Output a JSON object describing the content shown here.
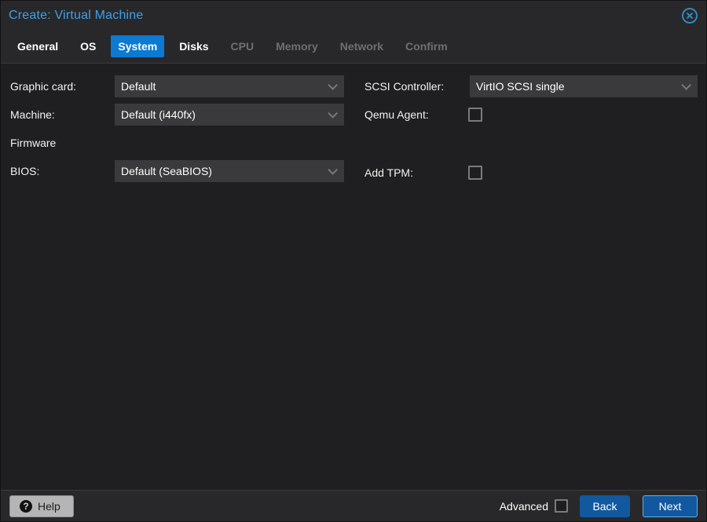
{
  "window": {
    "title": "Create: Virtual Machine"
  },
  "tabs": [
    {
      "label": "General",
      "state": "enabled"
    },
    {
      "label": "OS",
      "state": "enabled"
    },
    {
      "label": "System",
      "state": "active"
    },
    {
      "label": "Disks",
      "state": "enabled"
    },
    {
      "label": "CPU",
      "state": "disabled"
    },
    {
      "label": "Memory",
      "state": "disabled"
    },
    {
      "label": "Network",
      "state": "disabled"
    },
    {
      "label": "Confirm",
      "state": "disabled"
    }
  ],
  "form": {
    "left": {
      "graphic_card": {
        "label": "Graphic card:",
        "value": "Default"
      },
      "machine": {
        "label": "Machine:",
        "value": "Default (i440fx)"
      },
      "firmware_section": "Firmware",
      "bios": {
        "label": "BIOS:",
        "value": "Default (SeaBIOS)"
      }
    },
    "right": {
      "scsi_controller": {
        "label": "SCSI Controller:",
        "value": "VirtIO SCSI single"
      },
      "qemu_agent": {
        "label": "Qemu Agent:",
        "checked": false
      },
      "add_tpm": {
        "label": "Add TPM:",
        "checked": false
      }
    }
  },
  "footer": {
    "help_label": "Help",
    "advanced_label": "Advanced",
    "advanced_checked": false,
    "back_label": "Back",
    "next_label": "Next"
  },
  "colors": {
    "title_blue": "#3ba1ec",
    "tab_active_bg": "#0d7ad2",
    "tab_disabled_text": "#6f6f73",
    "chrome_bg": "#28282a",
    "body_bg": "#1f1f21",
    "field_bg": "#3a3a3c",
    "button_blue": "#11589e",
    "next_focus_border": "#66aede",
    "help_button_bg": "#b5b5b5",
    "close_icon_blue": "#2f88c0"
  }
}
